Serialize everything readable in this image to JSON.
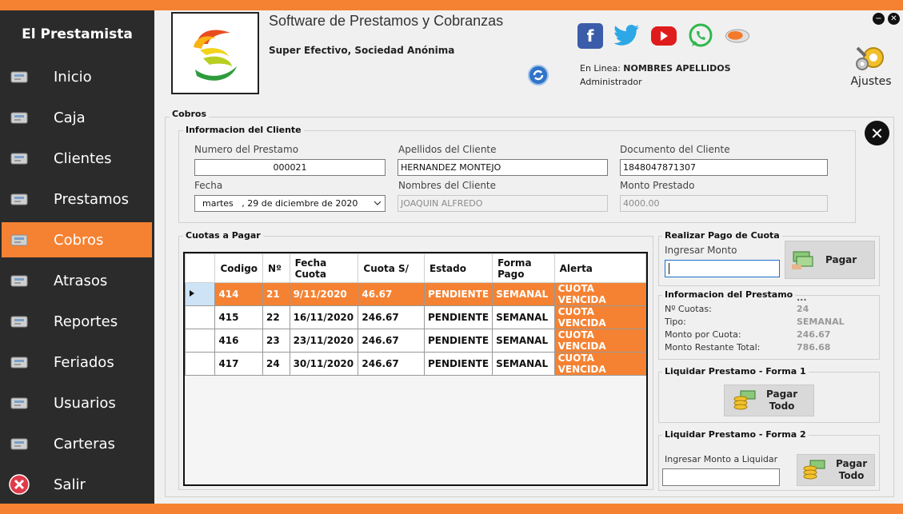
{
  "app": {
    "brand": "El Prestamista",
    "title": "Software de Prestamos y Cobranzas",
    "company": "Super Efectivo, Sociedad Anónima",
    "online_prefix": "En Linea: ",
    "online_user": "NOMBRES APELLIDOS",
    "role": "Administrador",
    "settings_label": "Ajustes"
  },
  "sidebar": {
    "items": [
      {
        "label": "Inicio",
        "icon": "bank-icon"
      },
      {
        "label": "Caja",
        "icon": "cash-register-icon"
      },
      {
        "label": "Clientes",
        "icon": "users-icon"
      },
      {
        "label": "Prestamos",
        "icon": "money-hand-icon"
      },
      {
        "label": "Cobros",
        "icon": "money-card-icon"
      },
      {
        "label": "Atrasos",
        "icon": "bills-icon"
      },
      {
        "label": "Reportes",
        "icon": "report-icon"
      },
      {
        "label": "Feriados",
        "icon": "calendar-icon"
      },
      {
        "label": "Usuarios",
        "icon": "user-lock-icon"
      },
      {
        "label": "Carteras",
        "icon": "wallet-icon"
      },
      {
        "label": "Salir",
        "icon": "exit-icon"
      }
    ],
    "active_index": 4
  },
  "cobros": {
    "frame_title": "Cobros",
    "cliente": {
      "legend": "Informacion del Cliente",
      "numero_label": "Numero del Prestamo",
      "numero_value": "000021",
      "apellidos_label": "Apellidos del Cliente",
      "apellidos_value": "HERNANDEZ MONTEJO",
      "documento_label": "Documento del Cliente",
      "documento_value": "1848047871307",
      "fecha_label": "Fecha",
      "fecha_value": "martes   , 29 de diciembre de 2020",
      "nombres_label": "Nombres del Cliente",
      "nombres_value": "JOAQUIN ALFREDO",
      "monto_label": "Monto Prestado",
      "monto_value": "4000.00"
    },
    "cuotas": {
      "legend": "Cuotas a Pagar",
      "columns": [
        "Codigo",
        "Nº",
        "Fecha Cuota",
        "Cuota S/",
        "Estado",
        "Forma Pago",
        "Alerta"
      ],
      "rows": [
        [
          "414",
          "21",
          "9/11/2020",
          "46.67",
          "PENDIENTE",
          "SEMANAL",
          "CUOTA VENCIDA"
        ],
        [
          "415",
          "22",
          "16/11/2020",
          "246.67",
          "PENDIENTE",
          "SEMANAL",
          "CUOTA VENCIDA"
        ],
        [
          "416",
          "23",
          "23/11/2020",
          "246.67",
          "PENDIENTE",
          "SEMANAL",
          "CUOTA VENCIDA"
        ],
        [
          "417",
          "24",
          "30/11/2020",
          "246.67",
          "PENDIENTE",
          "SEMANAL",
          "CUOTA VENCIDA"
        ]
      ],
      "selected_row": 0
    },
    "pago": {
      "legend": "Realizar Pago de Cuota",
      "ingresar_label": "Ingresar Monto",
      "ingresar_value": "",
      "pagar_label": "Pagar"
    },
    "prestamo": {
      "legend": "Informacion del Prestamo",
      "ellipsis": "...",
      "cuotas_label": "Nº Cuotas:",
      "cuotas_value": "24",
      "tipo_label": "Tipo:",
      "tipo_value": "SEMANAL",
      "monto_cuota_label": "Monto por Cuota:",
      "monto_cuota_value": "246.67",
      "restante_label": "Monto Restante Total:",
      "restante_value": "786.68"
    },
    "liquidar1": {
      "legend": "Liquidar Prestamo - Forma 1",
      "button_line1": "Pagar",
      "button_line2": "Todo"
    },
    "liquidar2": {
      "legend": "Liquidar Prestamo - Forma 2",
      "ingresar_label": "Ingresar Monto a Liquidar",
      "ingresar_value": "",
      "button_line1": "Pagar",
      "button_line2": "Todo"
    }
  },
  "colors": {
    "accent": "#f58232",
    "sidebar_bg": "#2b2b2b",
    "background": "#f0f0f0"
  }
}
